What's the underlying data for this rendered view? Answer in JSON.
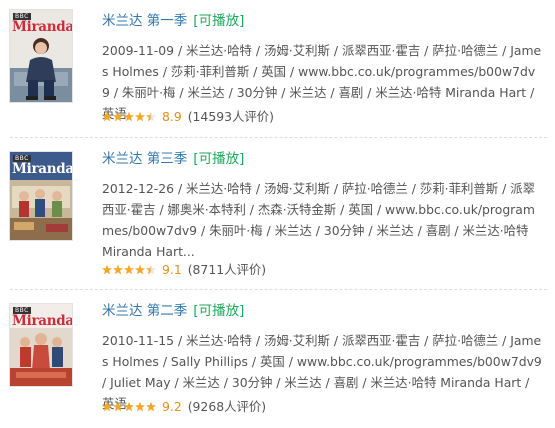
{
  "items": [
    {
      "cover": {
        "logo": "BBC",
        "title": "Miranda"
      },
      "title": "米兰达 第一季",
      "playable": "[可播放]",
      "meta": "2009-11-09 / 米兰达·哈特 / 汤姆·艾利斯 / 派翠西亚·霍吉 / 萨拉·哈德兰 / James Holmes / 莎莉·菲利普斯 / 英国 / www.bbc.co.uk/programmes/b00w7dv9 / 朱丽叶·梅 / 米兰达 / 30分钟 / 米兰达 / 喜剧 / 米兰达·哈特 Miranda Hart / 英语",
      "rating": {
        "stars_fraction": 0.9,
        "score": "8.9",
        "votes": "(14593人评价)"
      }
    },
    {
      "cover": {
        "logo": "BBC",
        "title": "Miranda"
      },
      "title": "米兰达 第三季",
      "playable": "[可播放]",
      "meta": "2012-12-26 / 米兰达·哈特 / 汤姆·艾利斯 / 萨拉·哈德兰 / 莎莉·菲利普斯 / 派翠西亚·霍吉 / 娜奥米·本特利 / 杰森·沃特金斯 / 英国 / www.bbc.co.uk/programmes/b00w7dv9 / 朱丽叶·梅 / 米兰达 / 30分钟 / 米兰达 / 喜剧 / 米兰达·哈特 Miranda Hart...",
      "rating": {
        "stars_fraction": 0.9,
        "score": "9.1",
        "votes": "(8711人评价)"
      }
    },
    {
      "cover": {
        "logo": "BBC",
        "title": "Miranda"
      },
      "title": "米兰达 第二季",
      "playable": "[可播放]",
      "meta": "2010-11-15 / 米兰达·哈特 / 汤姆·艾利斯 / 派翠西亚·霍吉 / 萨拉·哈德兰 / James Holmes / Sally Phillips / 英国 / www.bbc.co.uk/programmes/b00w7dv9 / Juliet May / 米兰达 / 30分钟 / 米兰达 / 喜剧 / 米兰达·哈特 Miranda Hart / 英语",
      "rating": {
        "stars_fraction": 1.0,
        "score": "9.2",
        "votes": "(9268人评价)"
      }
    }
  ],
  "colors": {
    "title_link": "#3377aa",
    "playable": "#20a65b",
    "star": "#f5a623",
    "score": "#e09015",
    "meta_text": "#545454"
  },
  "icons": [
    "star-icon",
    "half-star-icon"
  ]
}
